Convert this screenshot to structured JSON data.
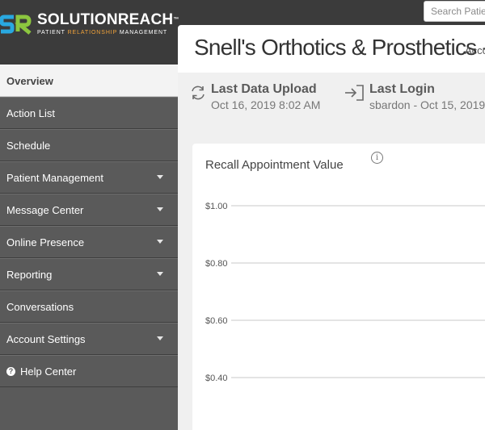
{
  "brand": {
    "name": "SOLUTIONREACH",
    "trademark": "™",
    "tagline_prefix": "PATIENT",
    "tagline_highlight": "RELATIONSHIP",
    "tagline_suffix": "MANAGEMENT",
    "colors": {
      "mark_blue": "#29a8e0",
      "mark_green": "#8cc63f",
      "accent": "#f2a33a"
    }
  },
  "search": {
    "placeholder": "Search Patients"
  },
  "header": {
    "title": "Snell's Orthotics & Prosthetics -",
    "subtitle": "Acco"
  },
  "sidebar": {
    "items": [
      {
        "label": "Overview",
        "active": true
      },
      {
        "label": "Action List"
      },
      {
        "label": "Schedule"
      },
      {
        "label": "Patient Management",
        "has_submenu": true
      },
      {
        "label": "Message Center",
        "has_submenu": true
      },
      {
        "label": "Online Presence",
        "has_submenu": true
      },
      {
        "label": "Reporting",
        "has_submenu": true
      },
      {
        "label": "Conversations"
      },
      {
        "label": "Account Settings",
        "has_submenu": true
      },
      {
        "label": "Help Center",
        "icon": "help-circle-icon"
      }
    ]
  },
  "stats": {
    "upload": {
      "label": "Last Data Upload",
      "value": "Oct 16, 2019 8:02 AM",
      "icon": "refresh-icon"
    },
    "login": {
      "label": "Last Login",
      "value": "sbardon - Oct 15, 2019",
      "icon": "sign-in-icon"
    }
  },
  "card": {
    "title": "Recall Appointment Value",
    "info_icon": "i"
  },
  "chart_data": {
    "type": "line",
    "title": "Recall Appointment Value",
    "y_ticks": [
      "$1.00",
      "$0.80",
      "$0.60",
      "$0.40"
    ],
    "ylim": [
      0.4,
      1.0
    ],
    "grid": true,
    "series": []
  }
}
